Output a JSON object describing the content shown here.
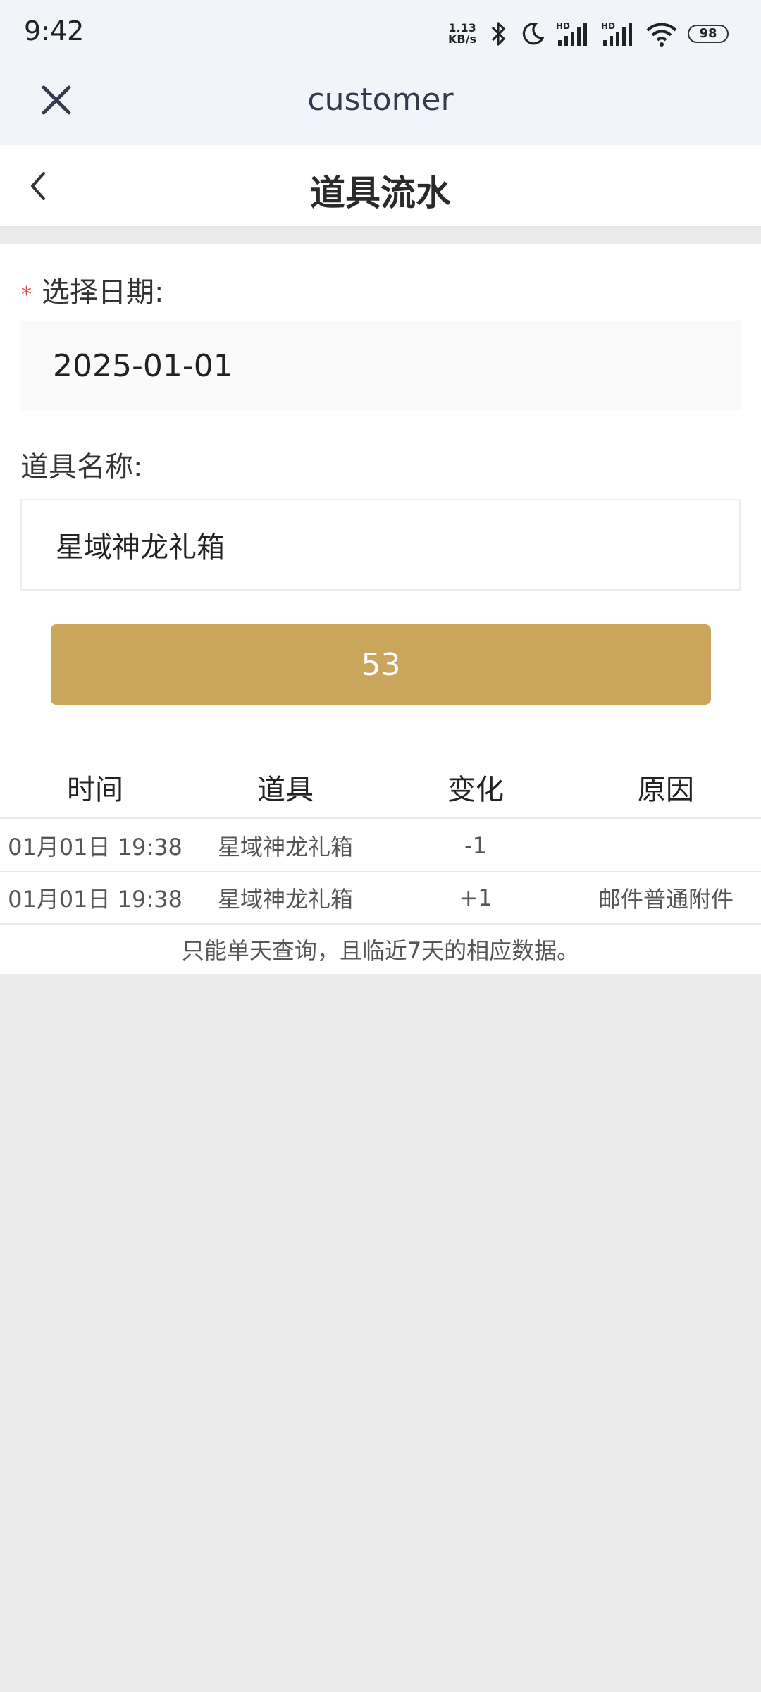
{
  "status_bar": {
    "time": "9:42",
    "net_speed_value": "1.13",
    "net_speed_unit": "KB/s",
    "battery": "98",
    "icons": [
      "bluetooth-icon",
      "moon-icon",
      "signal-hd-icon",
      "signal-hd-icon",
      "wifi-icon",
      "battery-icon"
    ]
  },
  "web_header": {
    "title": "customer",
    "close_icon": "close-icon"
  },
  "nav": {
    "title": "道具流水",
    "back_icon": "chevron-left-icon"
  },
  "form": {
    "date_required_mark": "*",
    "date_label": "选择日期:",
    "date_value": "2025-01-01",
    "item_label": "道具名称:",
    "item_value": "星域神龙礼箱",
    "query_button_label": "53"
  },
  "table": {
    "headers": [
      "时间",
      "道具",
      "变化",
      "原因"
    ],
    "rows": [
      [
        "01月01日 19:38",
        "星域神龙礼箱",
        "-1",
        ""
      ],
      [
        "01月01日 19:38",
        "星域神龙礼箱",
        "+1",
        "邮件普通附件"
      ]
    ]
  },
  "footnote": "只能单天查询，且临近7天的相应数据。",
  "colors": {
    "accent": "#caa55c",
    "required": "#e34d4d",
    "header_bg": "#f1f5f9",
    "page_bg": "#ebebeb"
  }
}
